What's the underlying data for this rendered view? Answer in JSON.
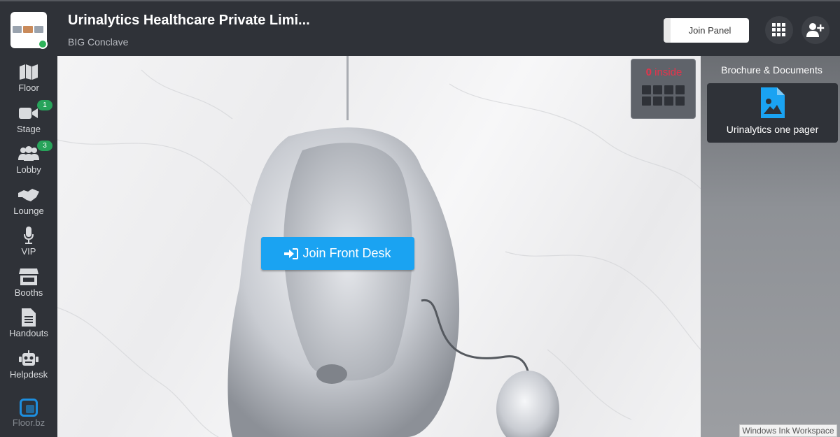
{
  "header": {
    "title": "Urinalytics Healthcare Private Limi...",
    "subtitle": "BIG Conclave",
    "join_panel_label": "Join Panel",
    "icons": [
      "grid-icon",
      "add-user-icon"
    ]
  },
  "sidebar": {
    "items": [
      {
        "label": "Floor",
        "icon": "map-icon"
      },
      {
        "label": "Stage",
        "icon": "video-icon",
        "badge": "1"
      },
      {
        "label": "Lobby",
        "icon": "users-icon",
        "badge": "3"
      },
      {
        "label": "Lounge",
        "icon": "handshake-icon"
      },
      {
        "label": "VIP",
        "icon": "microphone-icon"
      },
      {
        "label": "Booths",
        "icon": "store-icon"
      },
      {
        "label": "Handouts",
        "icon": "document-icon"
      },
      {
        "label": "Helpdesk",
        "icon": "robot-icon"
      }
    ],
    "brand": "Floor.bz"
  },
  "stage": {
    "join_front_desk_label": "Join Front Desk",
    "inside_count": "0",
    "inside_text": "inside"
  },
  "right_panel": {
    "title": "Brochure & Documents",
    "documents": [
      {
        "label": "Urinalytics one pager",
        "icon": "image-file-icon"
      }
    ]
  },
  "overlay": {
    "ink_workspace": "Windows Ink Workspace"
  },
  "colors": {
    "background": "#2f3238",
    "accent_blue": "#1aa3f2",
    "badge_green": "#27a35a",
    "inside_red": "#e8324a"
  }
}
